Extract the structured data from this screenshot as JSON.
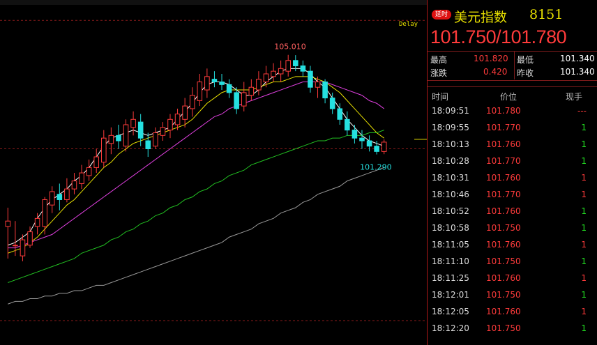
{
  "header": {
    "badge": "延时",
    "title": "美元指数",
    "code": "8151",
    "price_pair": "101.750/101.780"
  },
  "stats": {
    "high_label": "最高",
    "high_value": "101.820",
    "low_label": "最低",
    "low_value": "101.340",
    "change_label": "涨跌",
    "change_value": "0.420",
    "prev_close_label": "昨收",
    "prev_close_value": "101.340"
  },
  "ticks_header": {
    "time": "时间",
    "price": "价位",
    "volume": "现手"
  },
  "ticks": [
    {
      "time": "18:09:51",
      "price": "101.780",
      "volume": "---",
      "dir": "red"
    },
    {
      "time": "18:09:55",
      "price": "101.770",
      "volume": "1",
      "dir": "green"
    },
    {
      "time": "18:10:13",
      "price": "101.760",
      "volume": "1",
      "dir": "green"
    },
    {
      "time": "18:10:28",
      "price": "101.770",
      "volume": "1",
      "dir": "green"
    },
    {
      "time": "18:10:31",
      "price": "101.760",
      "volume": "1",
      "dir": "red"
    },
    {
      "time": "18:10:46",
      "price": "101.770",
      "volume": "1",
      "dir": "red"
    },
    {
      "time": "18:10:52",
      "price": "101.760",
      "volume": "1",
      "dir": "green"
    },
    {
      "time": "18:10:58",
      "price": "101.750",
      "volume": "1",
      "dir": "green"
    },
    {
      "time": "18:11:05",
      "price": "101.760",
      "volume": "1",
      "dir": "red"
    },
    {
      "time": "18:11:10",
      "price": "101.750",
      "volume": "1",
      "dir": "green"
    },
    {
      "time": "18:11:25",
      "price": "101.760",
      "volume": "1",
      "dir": "red"
    },
    {
      "time": "18:12:01",
      "price": "101.750",
      "volume": "1",
      "dir": "green"
    },
    {
      "time": "18:12:05",
      "price": "101.760",
      "volume": "1",
      "dir": "red"
    },
    {
      "time": "18:12:20",
      "price": "101.750",
      "volume": "1",
      "dir": "green"
    }
  ],
  "colors": {
    "up": "#ff3b3b",
    "down": "#25e0e0",
    "ma5": "#ffffff",
    "ma10": "#e8e000",
    "ma20": "#e040e0",
    "ma60": "#22c022",
    "ma120": "#9a9a9a",
    "grid": "#8a1a1a"
  },
  "chart_data": {
    "type": "candlestick",
    "delay_label": "Delay",
    "high_annotation": "105.010",
    "low_annotation": "101.290",
    "ylim": [
      94.3,
      106.8
    ],
    "ref_lines": [
      106.3,
      101.5
    ],
    "candles": [
      [
        98.6,
        99.3,
        97.4,
        98.8
      ],
      [
        97.9,
        98.8,
        97.5,
        97.9
      ],
      [
        97.5,
        98.3,
        97.3,
        98.1
      ],
      [
        97.9,
        98.6,
        97.8,
        98.4
      ],
      [
        98.6,
        99.1,
        98.3,
        98.9
      ],
      [
        98.6,
        99.7,
        98.3,
        99.6
      ],
      [
        99.4,
        100.1,
        99.1,
        99.9
      ],
      [
        99.8,
        100.2,
        99.2,
        99.6
      ],
      [
        99.6,
        100.4,
        99.5,
        100.0
      ],
      [
        100.0,
        100.6,
        99.8,
        100.3
      ],
      [
        100.2,
        100.9,
        100.0,
        100.6
      ],
      [
        100.5,
        101.1,
        100.3,
        100.8
      ],
      [
        100.8,
        101.5,
        100.6,
        101.2
      ],
      [
        101.0,
        102.2,
        100.8,
        101.9
      ],
      [
        101.7,
        102.3,
        101.3,
        102.0
      ],
      [
        102.0,
        102.4,
        101.5,
        101.8
      ],
      [
        101.6,
        102.6,
        101.4,
        102.4
      ],
      [
        102.3,
        102.9,
        102.0,
        102.6
      ],
      [
        102.5,
        102.8,
        101.6,
        101.9
      ],
      [
        101.8,
        102.1,
        101.2,
        101.5
      ],
      [
        101.6,
        102.3,
        101.5,
        102.1
      ],
      [
        102.0,
        102.5,
        101.8,
        102.3
      ],
      [
        102.2,
        102.8,
        101.9,
        102.6
      ],
      [
        102.4,
        103.0,
        102.2,
        102.8
      ],
      [
        102.6,
        103.4,
        102.3,
        103.1
      ],
      [
        103.0,
        103.8,
        102.7,
        103.5
      ],
      [
        103.3,
        104.3,
        103.1,
        104.0
      ],
      [
        103.7,
        104.5,
        103.4,
        104.2
      ],
      [
        104.1,
        104.4,
        103.8,
        104.0
      ],
      [
        104.0,
        104.3,
        103.7,
        103.9
      ],
      [
        103.9,
        104.1,
        103.4,
        103.6
      ],
      [
        103.6,
        103.8,
        102.8,
        103.0
      ],
      [
        103.1,
        104.0,
        102.9,
        103.6
      ],
      [
        103.5,
        104.1,
        103.3,
        103.8
      ],
      [
        103.7,
        104.4,
        103.5,
        104.1
      ],
      [
        104.0,
        104.6,
        103.8,
        104.3
      ],
      [
        104.2,
        104.7,
        104.0,
        104.4
      ],
      [
        104.3,
        104.8,
        104.0,
        104.5
      ],
      [
        104.4,
        105.01,
        104.2,
        104.8
      ],
      [
        104.8,
        105.0,
        104.4,
        104.6
      ],
      [
        104.6,
        104.8,
        104.2,
        104.4
      ],
      [
        104.4,
        104.6,
        103.6,
        103.8
      ],
      [
        103.8,
        104.2,
        103.4,
        104.0
      ],
      [
        104.0,
        104.1,
        103.2,
        103.4
      ],
      [
        103.4,
        103.6,
        102.8,
        103.0
      ],
      [
        103.0,
        103.2,
        102.4,
        102.6
      ],
      [
        102.6,
        102.9,
        102.0,
        102.2
      ],
      [
        102.2,
        102.4,
        101.7,
        101.9
      ],
      [
        101.9,
        102.2,
        101.5,
        101.8
      ],
      [
        101.8,
        102.0,
        101.4,
        101.6
      ],
      [
        101.6,
        101.8,
        101.29,
        101.4
      ],
      [
        101.4,
        101.85,
        101.3,
        101.75
      ]
    ],
    "ma_lines": [
      {
        "key": "ma5",
        "values": [
          97.9,
          98.0,
          98.2,
          98.4,
          98.9,
          99.3,
          99.6,
          99.8,
          100.0,
          100.3,
          100.5,
          100.8,
          101.2,
          101.6,
          101.9,
          102.0,
          102.1,
          102.2,
          102.1,
          102.0,
          102.1,
          102.2,
          102.3,
          102.6,
          102.9,
          103.2,
          103.6,
          103.9,
          104.0,
          104.0,
          103.9,
          103.7,
          103.5,
          103.5,
          103.7,
          104.0,
          104.2,
          104.4,
          104.5,
          104.5,
          104.5,
          104.3,
          104.0,
          103.8,
          103.4,
          103.0,
          102.6,
          102.3,
          102.0,
          101.8,
          101.7,
          101.6
        ]
      },
      {
        "key": "ma10",
        "values": [
          97.6,
          97.7,
          97.8,
          98.0,
          98.2,
          98.5,
          98.8,
          99.1,
          99.4,
          99.6,
          99.9,
          100.2,
          100.5,
          100.8,
          101.0,
          101.3,
          101.5,
          101.7,
          101.8,
          101.9,
          102.0,
          102.1,
          102.2,
          102.3,
          102.4,
          102.6,
          102.9,
          103.2,
          103.4,
          103.6,
          103.7,
          103.7,
          103.7,
          103.7,
          103.8,
          103.9,
          104.0,
          104.0,
          104.1,
          104.2,
          104.2,
          104.2,
          104.1,
          104.0,
          103.8,
          103.6,
          103.3,
          103.0,
          102.7,
          102.4,
          102.1,
          101.9
        ]
      },
      {
        "key": "ma20",
        "values": [
          97.8,
          97.8,
          97.9,
          98.0,
          98.1,
          98.2,
          98.3,
          98.5,
          98.7,
          98.9,
          99.1,
          99.3,
          99.5,
          99.7,
          99.9,
          100.1,
          100.3,
          100.5,
          100.7,
          100.9,
          101.1,
          101.3,
          101.5,
          101.7,
          101.9,
          102.1,
          102.3,
          102.5,
          102.7,
          102.8,
          103.0,
          103.1,
          103.2,
          103.3,
          103.4,
          103.5,
          103.6,
          103.7,
          103.8,
          103.9,
          104.0,
          104.0,
          104.0,
          104.0,
          103.9,
          103.8,
          103.7,
          103.6,
          103.5,
          103.3,
          103.2,
          103.0
        ]
      },
      {
        "key": "ma60",
        "values": [
          96.5,
          96.6,
          96.7,
          96.8,
          96.9,
          97.0,
          97.1,
          97.2,
          97.3,
          97.4,
          97.6,
          97.7,
          97.8,
          97.9,
          98.1,
          98.2,
          98.4,
          98.5,
          98.7,
          98.8,
          99.0,
          99.1,
          99.3,
          99.4,
          99.6,
          99.7,
          99.9,
          100.0,
          100.2,
          100.3,
          100.5,
          100.6,
          100.7,
          100.9,
          101.0,
          101.1,
          101.2,
          101.3,
          101.4,
          101.5,
          101.6,
          101.7,
          101.8,
          101.8,
          101.9,
          101.9,
          102.0,
          102.0,
          102.0,
          102.1,
          102.1,
          102.2
        ]
      },
      {
        "key": "ma120",
        "values": [
          95.7,
          95.8,
          95.8,
          95.9,
          95.9,
          96.0,
          96.0,
          96.1,
          96.1,
          96.2,
          96.2,
          96.3,
          96.4,
          96.4,
          96.5,
          96.6,
          96.7,
          96.8,
          96.9,
          97.0,
          97.1,
          97.2,
          97.3,
          97.4,
          97.5,
          97.6,
          97.7,
          97.8,
          97.9,
          98.0,
          98.2,
          98.3,
          98.4,
          98.5,
          98.7,
          98.8,
          98.9,
          99.1,
          99.2,
          99.3,
          99.5,
          99.6,
          99.8,
          99.9,
          100.0,
          100.1,
          100.3,
          100.4,
          100.5,
          100.6,
          100.7,
          100.8
        ]
      }
    ],
    "current_price": 101.75
  }
}
